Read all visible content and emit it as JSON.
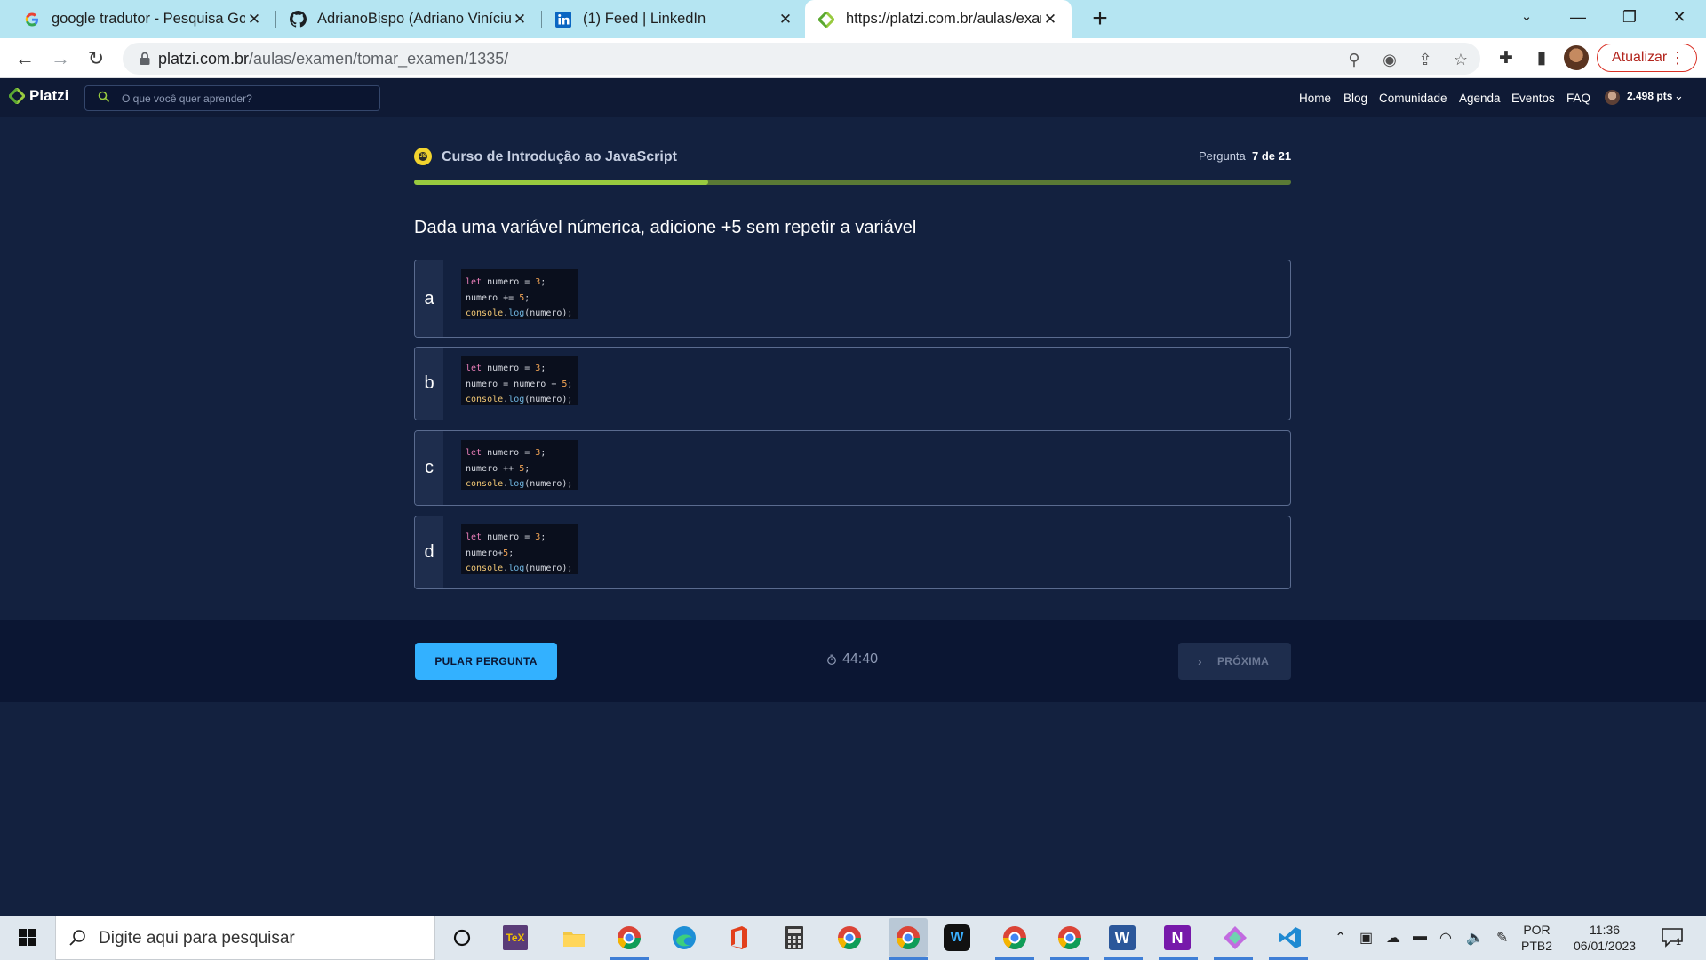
{
  "browser": {
    "tabs": [
      {
        "title": "google tradutor - Pesquisa Goog",
        "icon": "google-icon"
      },
      {
        "title": "AdrianoBispo (Adriano Vinícius B",
        "icon": "github-icon"
      },
      {
        "title": "(1) Feed | LinkedIn",
        "icon": "linkedin-icon"
      },
      {
        "title": "https://platzi.com.br/aulas/exam",
        "icon": "platzi-icon",
        "active": true
      }
    ],
    "url_host": "platzi.com.br",
    "url_path": "/aulas/examen/tomar_examen/1335/",
    "update_label": "Atualizar"
  },
  "platzi": {
    "logo_text": "Platzi",
    "search_placeholder": "O que você quer aprender?",
    "nav": [
      "Home",
      "Blog",
      "Comunidade",
      "Agenda",
      "Eventos",
      "FAQ"
    ],
    "points": "2.498 pts"
  },
  "exam": {
    "course_name": "Curso de Introdução ao JavaScript",
    "question_label": "Pergunta",
    "question_count": "7 de 21",
    "progress": 0.335,
    "question": "Dada uma variável númerica, adicione +5 sem repetir a variável",
    "options": [
      {
        "letter": "a",
        "lines": [
          "let numero = 3;",
          "numero += 5;",
          "console.log(numero);"
        ]
      },
      {
        "letter": "b",
        "lines": [
          "let numero = 3;",
          "numero = numero + 5;",
          "console.log(numero);"
        ]
      },
      {
        "letter": "c",
        "lines": [
          "let numero = 3;",
          "numero ++ 5;",
          "console.log(numero);"
        ]
      },
      {
        "letter": "d",
        "lines": [
          "let numero = 3;",
          "numero+5;",
          "console.log(numero);"
        ]
      }
    ],
    "skip_label": "PULAR PERGUNTA",
    "timer": "44:40",
    "next_label": "PRÓXIMA"
  },
  "taskbar": {
    "search_placeholder": "Digite aqui para pesquisar",
    "lang_line1": "POR",
    "lang_line2": "PTB2",
    "time": "11:36",
    "date": "06/01/2023",
    "notification_count": "1"
  },
  "colors": {
    "page_bg": "#13213f",
    "header_bg": "#0f1a35",
    "progress_fill": "#98ca3f",
    "skip_button": "#33b1ff",
    "tabbar": "#b5e5f2"
  }
}
